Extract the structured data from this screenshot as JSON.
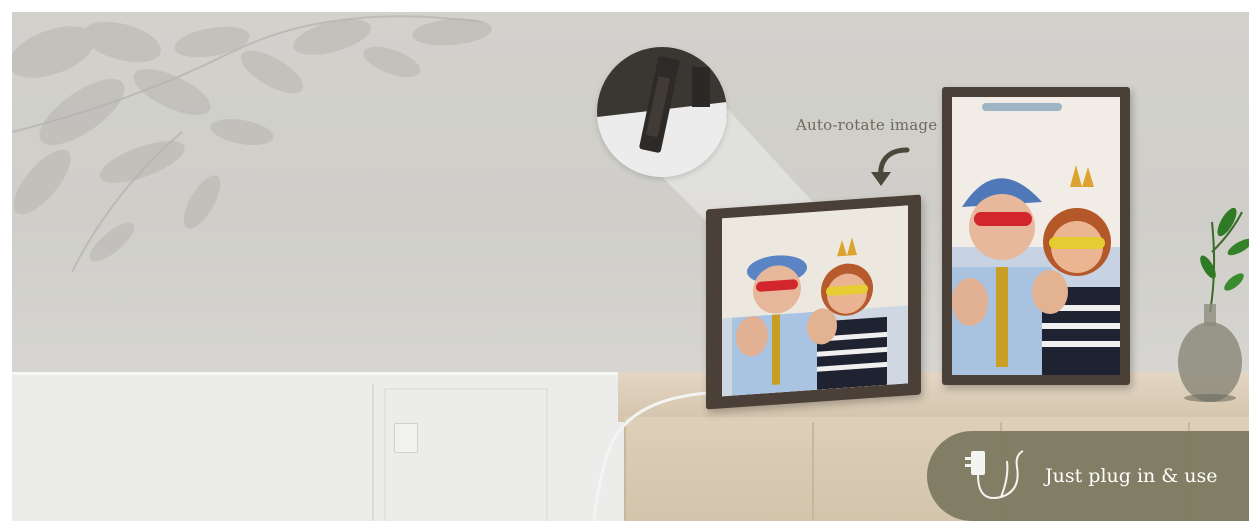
{
  "annotation": {
    "text": "Auto-rotate image"
  },
  "badge": {
    "text": "Just plug in & use"
  },
  "icons": [
    "curved-arrow-icon",
    "power-adapter-icon"
  ],
  "colors": {
    "badge_bg": "#79775e",
    "annotation_text": "#6c6a5a",
    "frame_wood": "#4b4038",
    "cabinet_wood": "#dccfb9",
    "wall": "#d0cfca"
  }
}
